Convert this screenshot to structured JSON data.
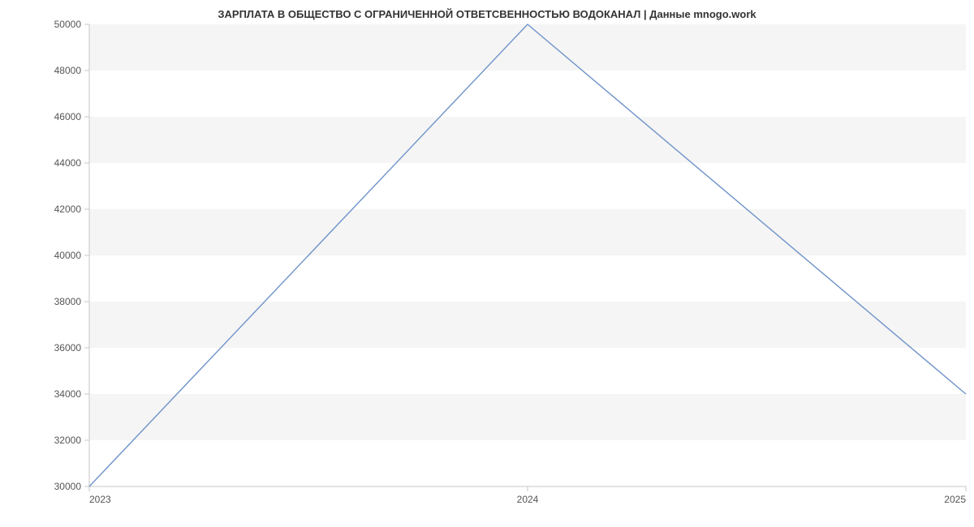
{
  "chart_data": {
    "type": "line",
    "title": "ЗАРПЛАТА В ОБЩЕСТВО С ОГРАНИЧЕННОЙ ОТВЕТСВЕННОСТЬЮ ВОДОКАНАЛ | Данные mnogo.work",
    "x": [
      2023,
      2024,
      2025
    ],
    "values": [
      30000,
      50000,
      34000
    ],
    "x_ticks": [
      2023,
      2024,
      2025
    ],
    "y_ticks": [
      30000,
      32000,
      34000,
      36000,
      38000,
      40000,
      42000,
      44000,
      46000,
      48000,
      50000
    ],
    "xlim": [
      2023,
      2025
    ],
    "ylim": [
      30000,
      50000
    ],
    "xlabel": "",
    "ylabel": "",
    "line_color": "#6f93c9",
    "grid_band_color": "#f5f5f5"
  }
}
